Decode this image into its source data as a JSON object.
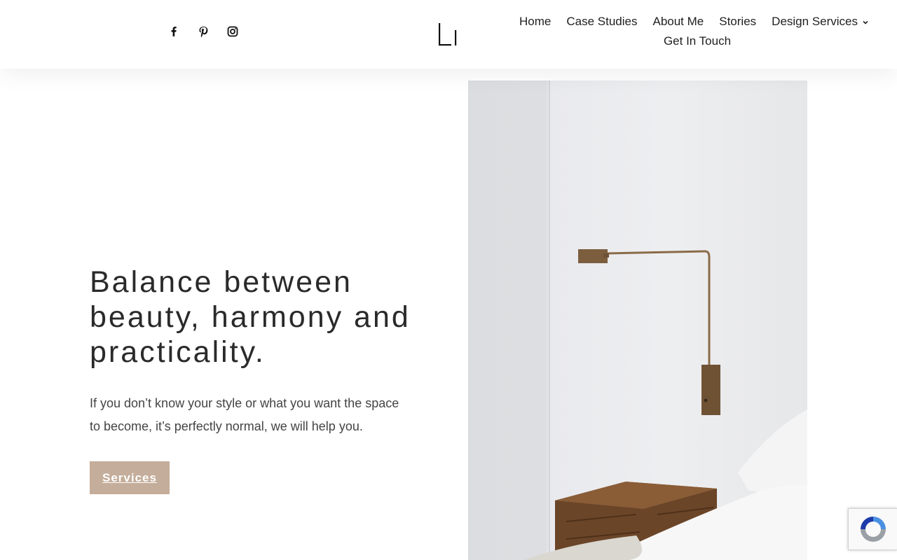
{
  "header": {
    "social": [
      {
        "name": "facebook-icon"
      },
      {
        "name": "pinterest-icon"
      },
      {
        "name": "instagram-icon"
      }
    ],
    "logo_icon": "brand-logo",
    "nav": {
      "home": "Home",
      "case_studies": "Case Studies",
      "about": "About Me",
      "stories": "Stories",
      "design_services": "Design Services",
      "get_in_touch": "Get In Touch"
    }
  },
  "hero": {
    "title_line1": "Balance between",
    "title_line2": "beauty, harmony and",
    "title_line3": "practicality.",
    "text_line1": "If you don’t know your style or what you want the space",
    "text_line2": "to become, it’s perfectly normal, we will help you.",
    "cta_label": "Services"
  },
  "colors": {
    "accent": "#c4ad9a",
    "text": "#2a2a2a"
  }
}
